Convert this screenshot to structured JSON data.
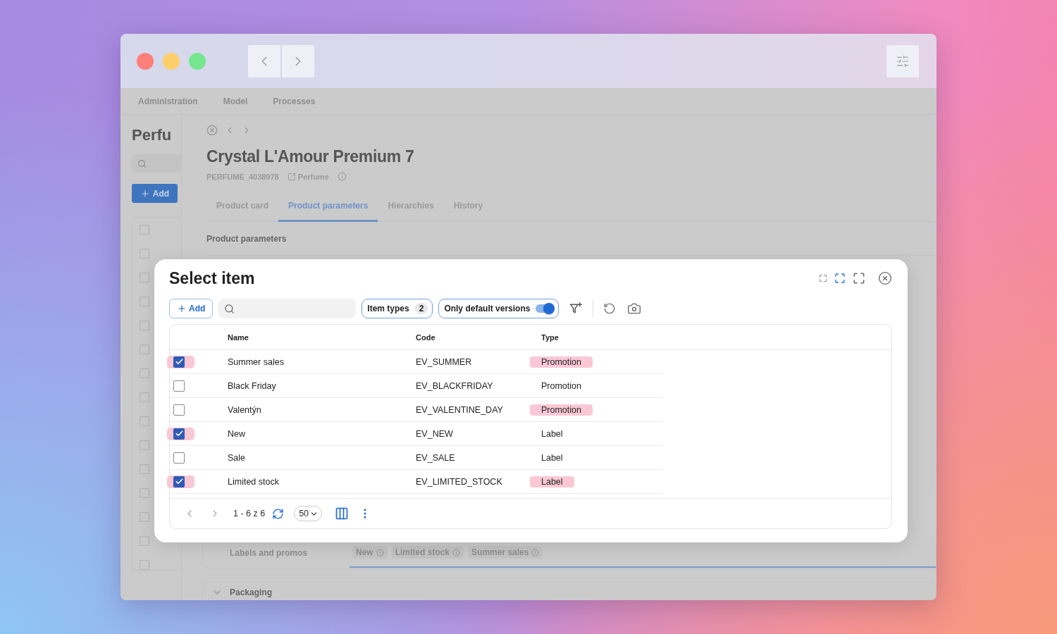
{
  "app": {
    "nav": [
      "Administration",
      "Model",
      "Processes"
    ],
    "sidebar": {
      "title": "Perfu",
      "add_button": "Add",
      "list_rows": [
        {
          "checked": false
        },
        {
          "checked": false
        },
        {
          "checked": false
        },
        {
          "checked": false
        },
        {
          "checked": false
        },
        {
          "checked": false
        },
        {
          "checked": false
        },
        {
          "checked": false
        },
        {
          "checked": false
        },
        {
          "checked": false
        },
        {
          "checked": false
        },
        {
          "checked": false
        },
        {
          "checked": false
        },
        {
          "checked": false
        },
        {
          "checked": false
        }
      ]
    },
    "product": {
      "title": "Crystal L'Amour Premium 7",
      "code": "PERFUME_4038978",
      "type_link": "Perfume",
      "tabs": [
        {
          "label": "Product card",
          "selected": false
        },
        {
          "label": "Product parameters",
          "selected": true
        },
        {
          "label": "Hierarchies",
          "selected": false
        },
        {
          "label": "History",
          "selected": false
        }
      ],
      "section": "Product parameters",
      "labels_row": {
        "label": "Labels and promos",
        "chips": [
          "New",
          "Limited stock",
          "Summer sales"
        ]
      },
      "next_section": "Packaging"
    }
  },
  "dialog": {
    "title": "Select item",
    "add_button": "Add",
    "filters": [
      {
        "kind": "count",
        "label": "Item types",
        "count": "2"
      },
      {
        "kind": "toggle",
        "label": "Only default versions",
        "on": true
      }
    ],
    "columns": [
      "Name",
      "Code",
      "Type"
    ],
    "rows": [
      {
        "checked": true,
        "name": "Summer sales",
        "code": "EV_SUMMER",
        "type": "Promotion",
        "highlighted": true
      },
      {
        "checked": false,
        "name": "Black Friday",
        "code": "EV_BLACKFRIDAY",
        "type": "Promotion",
        "highlighted": false
      },
      {
        "checked": false,
        "name": "Valentýn",
        "code": "EV_VALENTINE_DAY",
        "type": "Promotion",
        "highlighted": true
      },
      {
        "checked": true,
        "name": "New",
        "code": "EV_NEW",
        "type": "Label",
        "highlighted": false
      },
      {
        "checked": false,
        "name": "Sale",
        "code": "EV_SALE",
        "type": "Label",
        "highlighted": false
      },
      {
        "checked": true,
        "name": "Limited stock",
        "code": "EV_LIMITED_STOCK",
        "type": "Label",
        "highlighted": true
      }
    ],
    "pagination": {
      "range": "1 - 6 z 6",
      "page_size": "50"
    }
  }
}
